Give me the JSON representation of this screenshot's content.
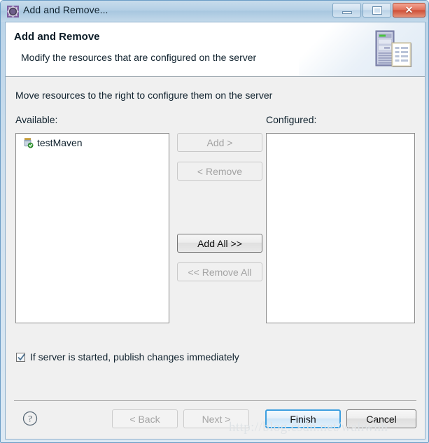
{
  "window": {
    "title": "Add and Remove...",
    "title_icon": "gear-icon",
    "controls": {
      "minimize": "Minimize",
      "maximize": "Maximize",
      "close": "Close",
      "close_glyph": "✕"
    }
  },
  "banner": {
    "title": "Add and Remove",
    "subtitle": "Modify the resources that are configured on the server",
    "icon": "server-tower-document-icon"
  },
  "main": {
    "instruction": "Move resources to the right to configure them on the server",
    "available_label": "Available:",
    "configured_label": "Configured:",
    "available_items": [
      {
        "label": "testMaven",
        "icon": "maven-module-jar-icon"
      }
    ],
    "configured_items": [],
    "transfer_buttons": [
      {
        "label": "Add >",
        "enabled": false
      },
      {
        "label": "< Remove",
        "enabled": false
      },
      {
        "label": "Add All >>",
        "enabled": true
      },
      {
        "label": "<< Remove All",
        "enabled": false
      }
    ],
    "publish_checkbox": {
      "label": "If server is started, publish changes immediately",
      "checked": true
    }
  },
  "footer": {
    "help_label": "?",
    "buttons": [
      {
        "id": "back",
        "label": "< Back",
        "state": "disabled"
      },
      {
        "id": "next",
        "label": "Next >",
        "state": "disabled"
      },
      {
        "id": "finish",
        "label": "Finish",
        "state": "default"
      },
      {
        "id": "cancel",
        "label": "Cancel",
        "state": "normal"
      }
    ]
  },
  "watermark": "http://blog.csdn.net/wahwhh",
  "colors": {
    "frame": "#b9d3e8",
    "client_bg": "#f0f0f0",
    "banner_bg": "#ffffff",
    "listbox_bg": "#ffffff",
    "default_button_border": "#3c9fe0",
    "disabled_text": "#a3a3a3",
    "text": "#10222e",
    "watermark": "#dfe3e6"
  }
}
